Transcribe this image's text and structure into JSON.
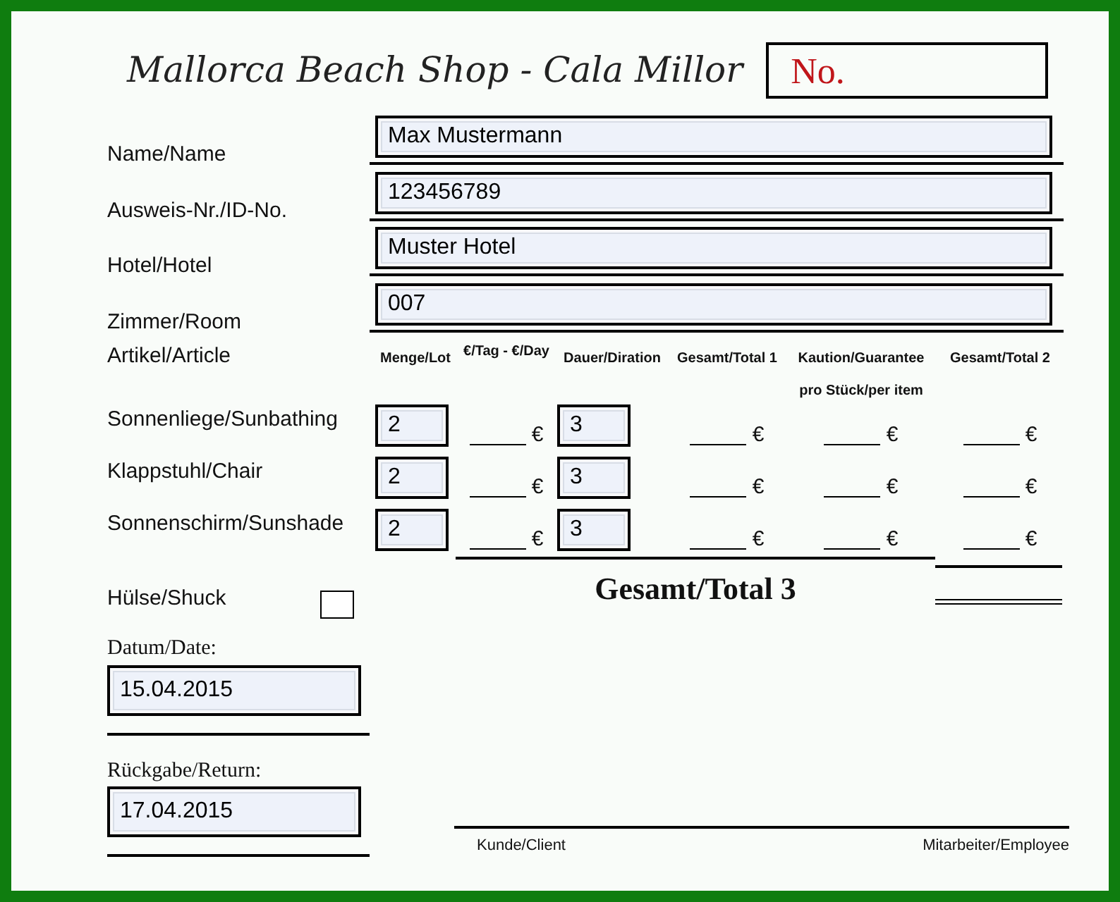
{
  "header": {
    "title": "Mallorca Beach Shop - Cala Millor",
    "number_label": "No."
  },
  "fields": [
    {
      "label": "Name/Name",
      "value": "Max Mustermann"
    },
    {
      "label": "Ausweis-Nr./ID-No.",
      "value": "123456789"
    },
    {
      "label": "Hotel/Hotel",
      "value": "Muster Hotel"
    },
    {
      "label": "Zimmer/Room",
      "value": "007"
    }
  ],
  "articles": {
    "label": "Artikel/Article",
    "columns": [
      "Menge/Lot",
      "€/Tag - €/Day",
      "Dauer/Diration",
      "Gesamt/Total 1",
      "Kaution/Guarantee",
      "Gesamt/Total 2"
    ],
    "deposit_subheading": "pro Stück/per item",
    "rows": [
      {
        "label": "Sonnenliege/Sunbathing",
        "lot": "2",
        "per_day_currency": "€",
        "duration": "3",
        "total1_currency": "€",
        "deposit_currency": "€",
        "total2_currency": "€"
      },
      {
        "label": "Klappstuhl/Chair",
        "lot": "2",
        "per_day_currency": "€",
        "duration": "3",
        "total1_currency": "€",
        "deposit_currency": "€",
        "total2_currency": "€"
      },
      {
        "label": "Sonnenschirm/Sunshade",
        "lot": "2",
        "per_day_currency": "€",
        "duration": "3",
        "total1_currency": "€",
        "deposit_currency": "€",
        "total2_currency": "€"
      }
    ],
    "total_label": "Gesamt/Total 3"
  },
  "sleeve": {
    "label": "Hülse/Shuck",
    "checked": false
  },
  "dates": [
    {
      "label": "Datum/Date:",
      "value": "15.04.2015"
    },
    {
      "label": "Rückgabe/Return:",
      "value": "17.04.2015"
    }
  ],
  "signatures": {
    "client": "Kunde/Client",
    "employee": "Mitarbeiter/Employee"
  }
}
